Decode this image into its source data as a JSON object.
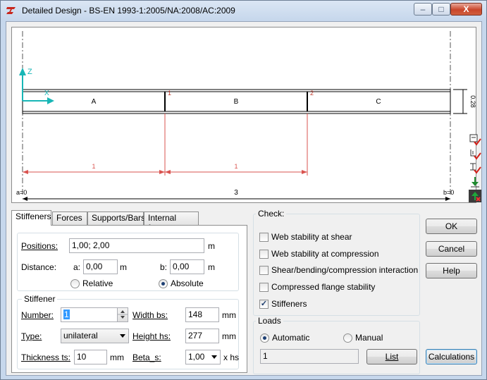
{
  "window": {
    "title": "Detailed Design - BS-EN 1993-1:2005/NA:2008/AC:2009",
    "controls": {
      "minimize": "‒",
      "maximize": "□",
      "close": "X"
    }
  },
  "drawing": {
    "axis_z": "Z",
    "axis_x": "X",
    "segments": [
      "A",
      "B",
      "C"
    ],
    "marker_1": "1",
    "marker_2": "2",
    "height_dim": "0.28",
    "dim_ab": "1",
    "dim_bc": "1",
    "left_label": "a=0",
    "right_label": "b=0",
    "total_dim": "3",
    "tool_icons": [
      "stiffener-check-icon",
      "rotate-check-icon",
      "section-check-icon",
      "move-down-icon",
      "add-delete-icon"
    ]
  },
  "tabs": [
    {
      "label": "Stiffeners"
    },
    {
      "label": "Forces"
    },
    {
      "label": "Supports/Bars"
    },
    {
      "label": "Internal forces"
    }
  ],
  "stiffeners": {
    "positions_label": "Positions:",
    "positions_value": "1,00; 2,00",
    "positions_unit": "m",
    "distance_label": "Distance:",
    "a_label": "a:",
    "a_value": "0,00",
    "a_unit": "m",
    "b_label": "b:",
    "b_value": "0,00",
    "b_unit": "m",
    "relative_label": "Relative",
    "absolute_label": "Absolute",
    "selected_mode": "Absolute"
  },
  "stiffener": {
    "group_title": "Stiffener",
    "number_label": "Number:",
    "number_value": "1",
    "type_label": "Type:",
    "type_value": "unilateral",
    "thickness_label": "Thickness ts:",
    "thickness_value": "10",
    "thickness_unit": "mm",
    "width_label": "Width bs:",
    "width_value": "148",
    "width_unit": "mm",
    "height_label": "Height hs:",
    "height_value": "277",
    "height_unit": "mm",
    "beta_label": "Beta_s:",
    "beta_value": "1,00",
    "beta_unit": "x hs"
  },
  "check": {
    "title": "Check:",
    "items": [
      {
        "label": "Web stability at shear",
        "checked": false
      },
      {
        "label": "Web stability at compression",
        "checked": false
      },
      {
        "label": "Shear/bending/compression interaction",
        "checked": false
      },
      {
        "label": "Compressed flange stability",
        "checked": false
      },
      {
        "label": "Stiffeners",
        "checked": true
      }
    ],
    "check_mark": "✓"
  },
  "loads": {
    "title": "Loads",
    "automatic_label": "Automatic",
    "manual_label": "Manual",
    "selected": "Automatic",
    "field_value": "1",
    "list_label": "List"
  },
  "buttons": {
    "ok": "OK",
    "cancel": "Cancel",
    "help": "Help",
    "calculations": "Calculations"
  }
}
